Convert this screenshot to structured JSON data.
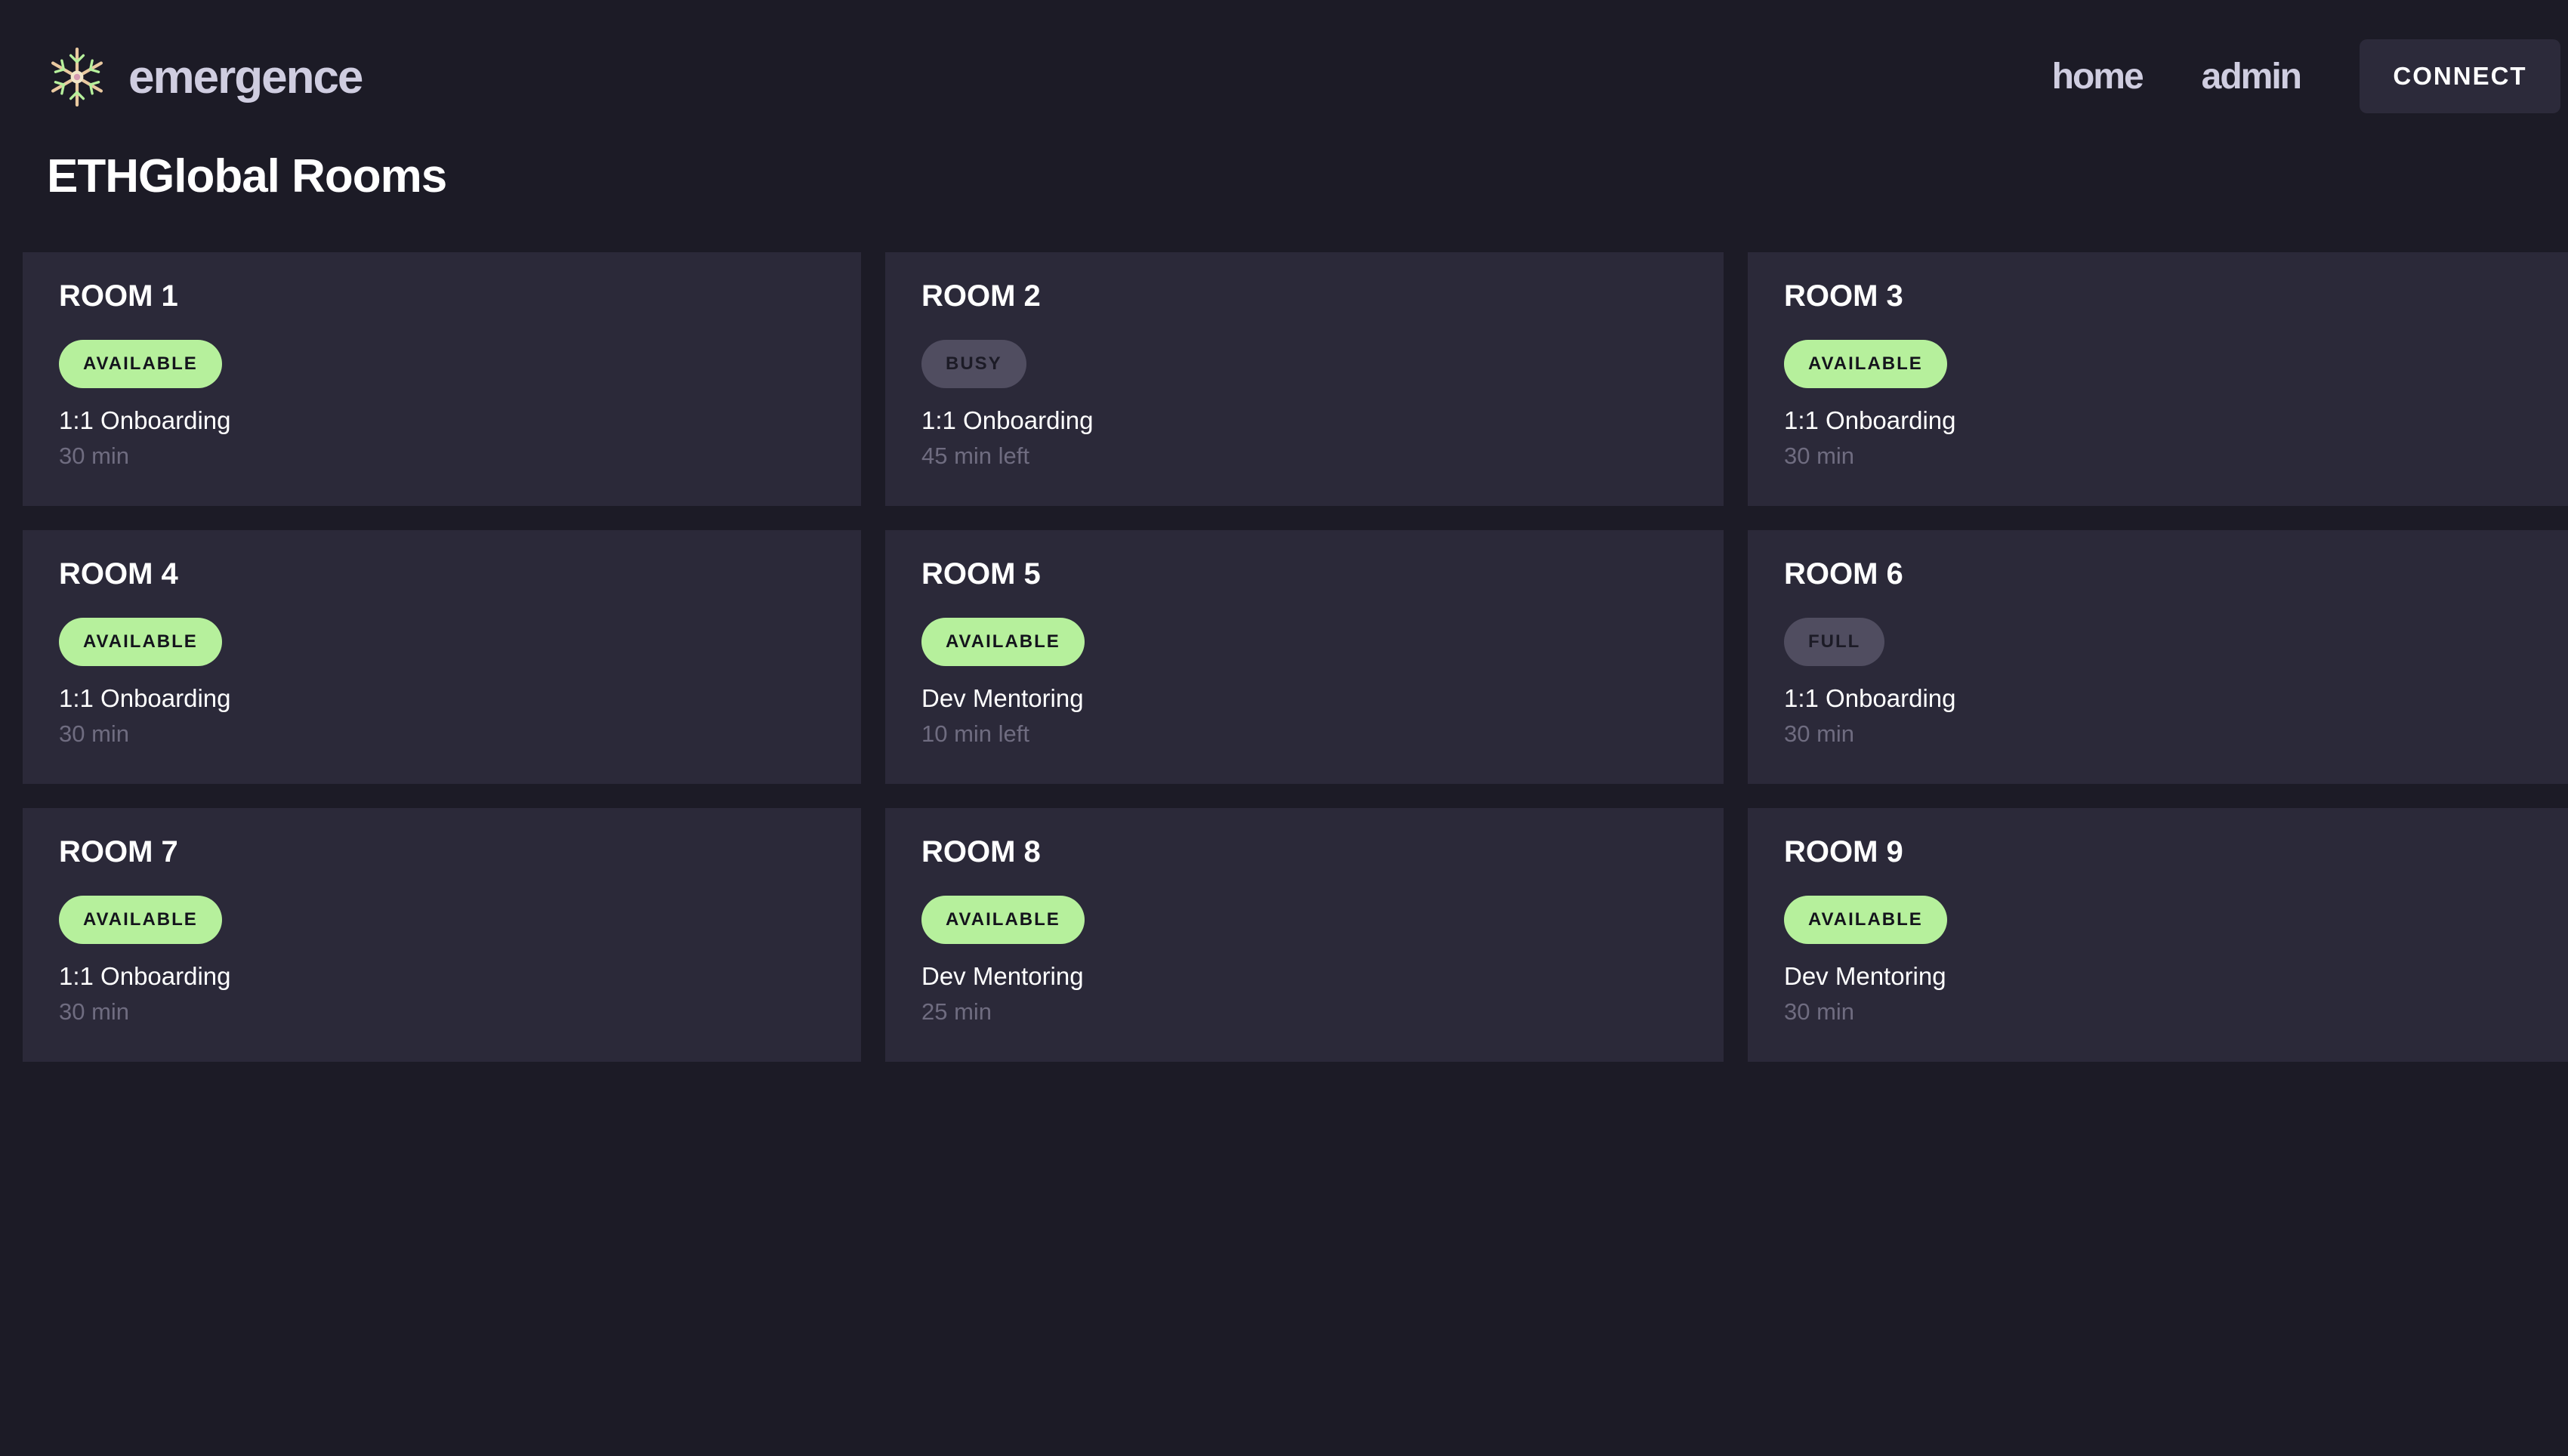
{
  "brand": {
    "name": "emergence",
    "logo_icon": "snowflake-logo-icon"
  },
  "nav": {
    "home": "home",
    "admin": "admin",
    "connect": "CONNECT"
  },
  "page": {
    "title": "ETHGlobal Rooms"
  },
  "colors": {
    "background": "#1c1b26",
    "card": "#2b2939",
    "available": "#b6f09c",
    "unavailable": "#504d60",
    "muted_text": "#6f6c80"
  },
  "rooms": [
    {
      "name": "ROOM 1",
      "status": "AVAILABLE",
      "status_type": "available",
      "activity": "1:1 Onboarding",
      "time": "30 min"
    },
    {
      "name": "ROOM 2",
      "status": "BUSY",
      "status_type": "busy",
      "activity": "1:1 Onboarding",
      "time": "45 min left"
    },
    {
      "name": "ROOM 3",
      "status": "AVAILABLE",
      "status_type": "available",
      "activity": "1:1 Onboarding",
      "time": "30 min"
    },
    {
      "name": "ROOM 4",
      "status": "AVAILABLE",
      "status_type": "available",
      "activity": "1:1 Onboarding",
      "time": "30 min"
    },
    {
      "name": "ROOM 5",
      "status": "AVAILABLE",
      "status_type": "available",
      "activity": "Dev Mentoring",
      "time": "10 min left"
    },
    {
      "name": "ROOM 6",
      "status": "FULL",
      "status_type": "busy",
      "activity": "1:1 Onboarding",
      "time": "30 min"
    },
    {
      "name": "ROOM 7",
      "status": "AVAILABLE",
      "status_type": "available",
      "activity": "1:1 Onboarding",
      "time": "30 min"
    },
    {
      "name": "ROOM 8",
      "status": "AVAILABLE",
      "status_type": "available",
      "activity": "Dev Mentoring",
      "time": "25 min"
    },
    {
      "name": "ROOM 9",
      "status": "AVAILABLE",
      "status_type": "available",
      "activity": "Dev Mentoring",
      "time": "30 min"
    }
  ]
}
